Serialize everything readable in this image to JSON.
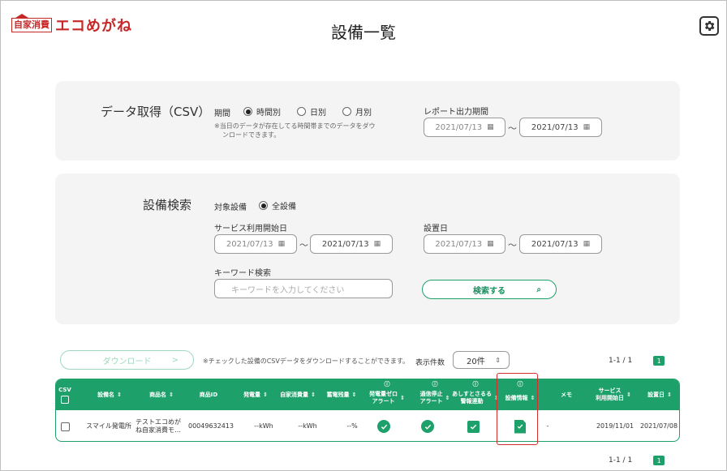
{
  "header": {
    "logo_box": "自家消費",
    "logo_text": "エコめがね",
    "title": "設備一覧"
  },
  "csv_panel": {
    "title": "データ取得（CSV）",
    "period_label": "期間",
    "options": [
      "時間別",
      "日別",
      "月別"
    ],
    "selected": "時間別",
    "note_line1": "※当日のデータが存在してる時間帯までのデータをダウ",
    "note_line2": "ンロードできます。",
    "report_label": "レポート出力期間",
    "from": "2021/07/13",
    "to": "2021/07/13",
    "dash": "〜"
  },
  "search_panel": {
    "title": "設備検索",
    "target_label": "対象設備",
    "target_option": "全設備",
    "start_label": "サービス利用開始日",
    "start_from": "2021/07/13",
    "start_to": "2021/07/13",
    "install_label": "設置日",
    "install_from": "2021/07/13",
    "install_to": "2021/07/13",
    "keyword_label": "キーワード検索",
    "keyword_placeholder": "キーワードを入力してください",
    "search_button": "検索する",
    "dash": "〜"
  },
  "toolbar": {
    "download": "ダウンロード",
    "note": "※チェックした設備のCSVデータをダウンロードすることができます。",
    "count_label": "表示件数",
    "count_value": "20件",
    "pager_text": "1-1 / 1",
    "page": "1"
  },
  "table": {
    "headers": {
      "csv": "CSV",
      "facility": "設備名",
      "product": "商品名",
      "product_id": "商品ID",
      "generation": "発電量",
      "self_consumption": "自家消費量",
      "battery": "蓄電残量",
      "zero_alert_1": "発電量ゼロ",
      "zero_alert_2": "アラート",
      "comm_alert_1": "通信停止",
      "comm_alert_2": "アラート",
      "ashita_1": "あしすとさるる",
      "ashita_2": "警報連動",
      "equipment_info": "設備情報",
      "memo": "メモ",
      "service_1": "サービス",
      "service_2": "利用開始日",
      "install_date": "設置日"
    },
    "row": {
      "facility": "スマイル発電所",
      "product_line1": "テストエコめが",
      "product_line2": "ね自家消費モ…",
      "product_id": "00049632413",
      "generation": "--kWh",
      "self_consumption": "--kWh",
      "battery": "--%",
      "memo": "-",
      "service_start": "2019/11/01",
      "install_date": "2021/07/08"
    }
  },
  "icons": {
    "settings": "gear-icon",
    "calendar": "calendar-icon",
    "search": "search-icon",
    "check": "check-icon",
    "info": "info-icon",
    "sort": "sort-icon"
  },
  "colors": {
    "brand": "#c62828",
    "accent": "#1ea06b",
    "highlight": "#d32f2f"
  }
}
